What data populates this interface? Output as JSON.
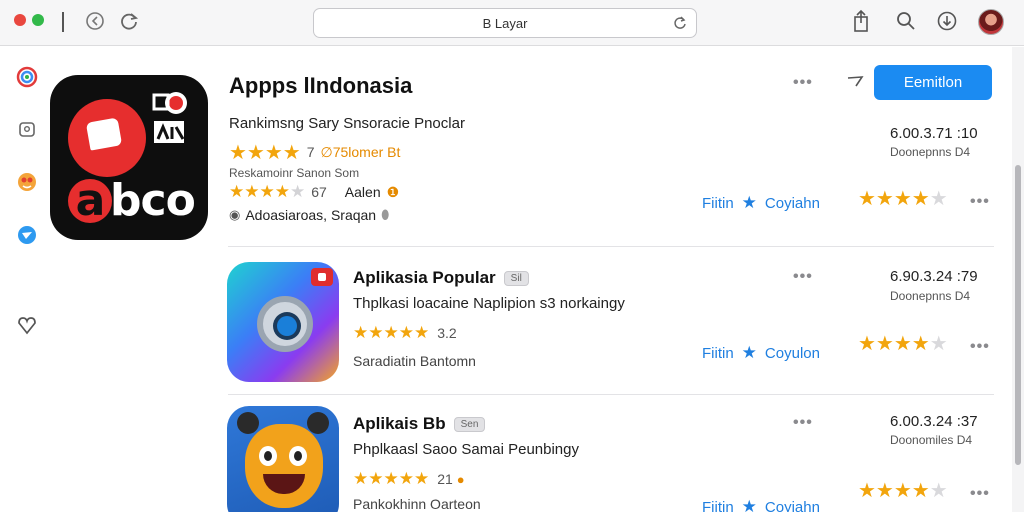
{
  "toolbar": {
    "address": "B Layar"
  },
  "featured": {
    "icon_word": "bco",
    "icon_letter": "a",
    "title": "Appps lIndonasia",
    "subtitle": "Rankimsng Sary Snsoracie Pnoclar",
    "rating_value": "7",
    "rating_text": "∅75lomer Bt",
    "small_label": "Reskamoinr Sanon Som",
    "second_rating": "67",
    "second_label": "Aalen",
    "line_text": "Adoasiaroas, Sraqan",
    "get_label": "Eemitlon",
    "meta_number": "6.00.3.71 :10",
    "meta_sub": "Doonepnns D4",
    "rate_link_left": "Fiitin",
    "rate_link_right": "Coyiahn",
    "rating_stars": 4
  },
  "apps": [
    {
      "title": "Aplikasia Popular",
      "badge": "Sil",
      "desc": "Thplkasi loacaine Naplipion s3 norkaingy",
      "rating": "3.2",
      "category": "Saradiatin Bantomn",
      "meta_number": "6.90.3.24 :79",
      "meta_sub": "Doonepnns D4",
      "rate_link_left": "Fiitin",
      "rate_link_right": "Coyulon",
      "rating_stars": 4
    },
    {
      "title": "Aplikais Bb",
      "badge": "Sen",
      "desc": "Phplkaasl Saoo Samai Peunbingy",
      "rating": "21",
      "category": "Pankokhinn Oarteon",
      "meta_number": "6.00.3.24 :37",
      "meta_sub": "Doonomiles D4",
      "rate_link_left": "Fiitin",
      "rate_link_right": "Coyiahn",
      "rating_stars": 4
    }
  ]
}
